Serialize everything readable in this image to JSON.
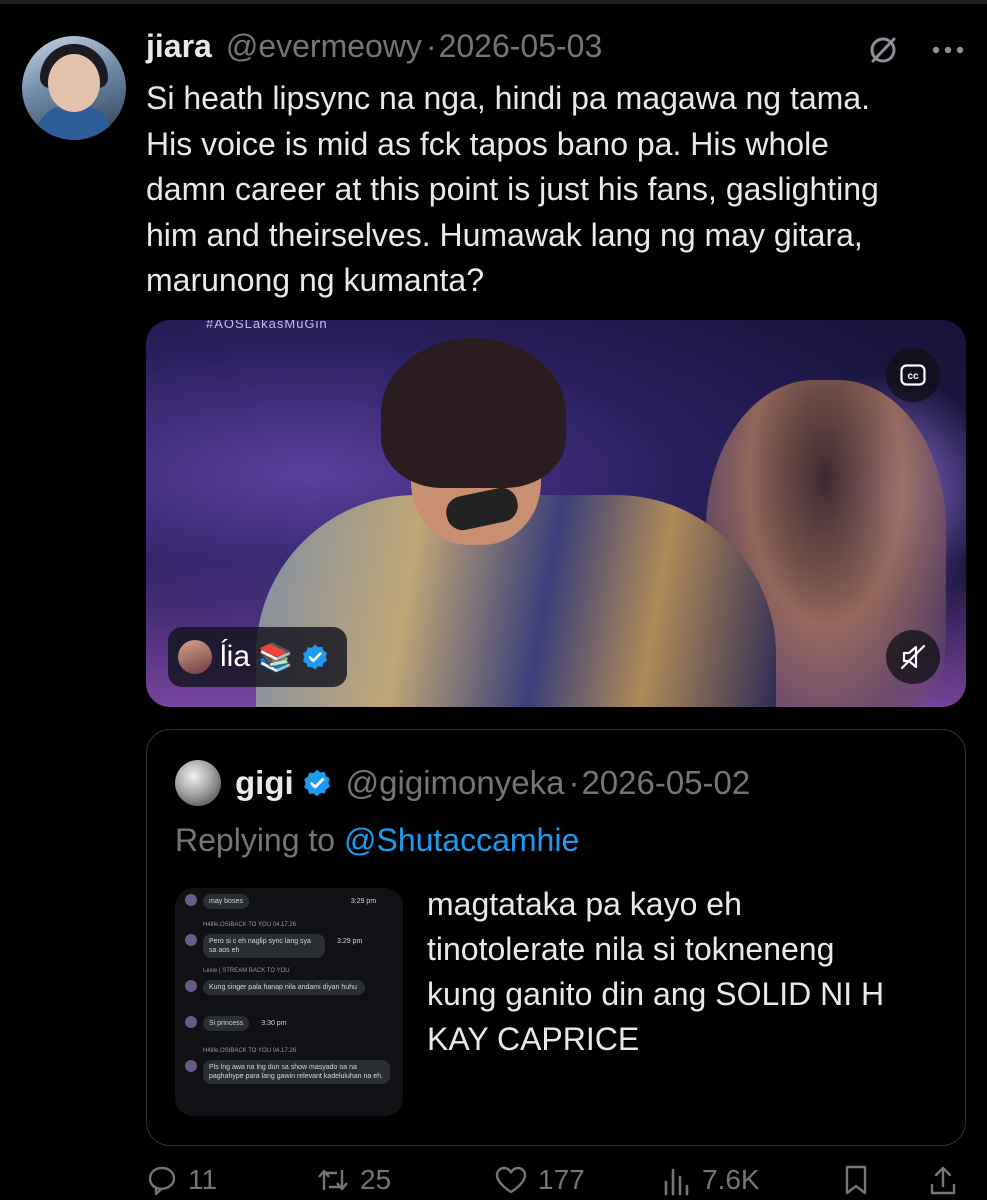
{
  "post": {
    "author_name": "jiara",
    "author_handle": "@evermeowy",
    "separator": "·",
    "date": "2026-05-03",
    "text": "Si heath lipsync na nga, hindi pa magawa ng tama.\nHis voice is mid as fck tapos bano pa. His whole\ndamn career at this point is just his fans, gaslighting\nhim and theirselves. Humawak lang ng may gitara,\nmarunong ng kumanta?",
    "menu_icon": "more-dots-icon",
    "grok_icon": "grok-icon"
  },
  "media": {
    "caption_top": "#AOSLakasMuGin",
    "tag_name": "ĺia",
    "tag_emoji": "📚",
    "cc_icon": "closed-captions-icon",
    "mute_icon": "muted-speaker-icon"
  },
  "quote": {
    "author_name": "gigi",
    "author_handle": "@gigimonyeka",
    "separator": "·",
    "date": "2026-05-02",
    "replying_prefix": "Replying to",
    "replying_to": "@Shutaccamhie",
    "text": "magtataka pa kayo eh\ntinotolerate nila si tokneneng\nkung ganito din ang SOLID NI H\nKAY CAPRICE",
    "image_chat": [
      {
        "text": "may boses",
        "time": "3:29 pm"
      },
      {
        "meta": "H4life,OSIBACK TO YOU 04.17.26"
      },
      {
        "text": "Pero si c eh naglip sync lang sya sa aos eh",
        "time": "3:29 pm"
      },
      {
        "meta": "Lexie | STREAM BACK TO YOU"
      },
      {
        "text": "Kung singer pala hanap nila andami diyan huhu"
      },
      {
        "text": "Si princess",
        "time": "3:30 pm"
      },
      {
        "meta": "H4life,OSIBACK TO YOU 04.17.26"
      },
      {
        "text": "Pls lng awa na lng dun sa show masyado oa na paghahype para lang gawin relevant kadeluluhan na eh."
      }
    ]
  },
  "actions": {
    "replies": "11",
    "reposts": "25",
    "likes": "177",
    "views": "7.6K"
  },
  "colors": {
    "background": "#000000",
    "text": "#e7e9ea",
    "muted": "#71767b",
    "link": "#1d9bf0",
    "border": "#2f3336"
  }
}
